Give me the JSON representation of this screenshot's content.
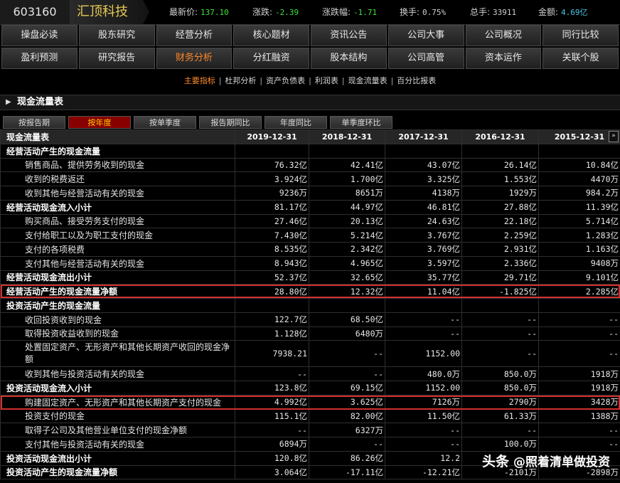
{
  "header": {
    "code": "603160",
    "name": "汇顶科技",
    "quotes": [
      {
        "k": "最新价:",
        "v": "137.10",
        "color": "green"
      },
      {
        "k": "涨跌:",
        "v": "-2.39",
        "color": "green"
      },
      {
        "k": "涨跌幅:",
        "v": "-1.71",
        "color": "green"
      },
      {
        "k": "换手:",
        "v": "0.75%",
        "color": "gray"
      },
      {
        "k": "总手:",
        "v": "33911",
        "color": "gray"
      },
      {
        "k": "金额:",
        "v": "4.69亿",
        "color": "cyan"
      }
    ]
  },
  "nav_row1": [
    "操盘必读",
    "股东研究",
    "经营分析",
    "核心题材",
    "资讯公告",
    "公司大事",
    "公司概况",
    "同行比较"
  ],
  "nav_row2": [
    "盈利预测",
    "研究报告",
    "财务分析",
    "分红融资",
    "股本结构",
    "公司高管",
    "资本运作",
    "关联个股"
  ],
  "subnav": [
    "主要指标",
    "杜邦分析",
    "资产负债表",
    "利润表",
    "现金流量表",
    "百分比报表"
  ],
  "section_title": "现金流量表",
  "tabs": [
    "按报告期",
    "按年度",
    "按单季度",
    "报告期同比",
    "年度同比",
    "单季度环比"
  ],
  "table": {
    "headers": [
      "现金流量表",
      "2019-12-31",
      "2018-12-31",
      "2017-12-31",
      "2016-12-31",
      "2015-12-31"
    ],
    "rows": [
      {
        "type": "h",
        "label": "经营活动产生的现金流量",
        "vals": [
          "",
          "",
          "",
          "",
          ""
        ]
      },
      {
        "type": "d",
        "label": "销售商品、提供劳务收到的现金",
        "vals": [
          "76.32亿",
          "42.41亿",
          "43.07亿",
          "26.14亿",
          "10.84亿"
        ]
      },
      {
        "type": "d",
        "label": "收到的税费返还",
        "vals": [
          "3.924亿",
          "1.700亿",
          "3.325亿",
          "1.553亿",
          "4470万"
        ]
      },
      {
        "type": "d",
        "label": "收到其他与经营活动有关的现金",
        "vals": [
          "9236万",
          "8651万",
          "4138万",
          "1929万",
          "984.2万"
        ]
      },
      {
        "type": "h",
        "label": "经营活动现金流入小计",
        "vals": [
          "81.17亿",
          "44.97亿",
          "46.81亿",
          "27.88亿",
          "11.39亿"
        ]
      },
      {
        "type": "d",
        "label": "购买商品、接受劳务支付的现金",
        "vals": [
          "27.46亿",
          "20.13亿",
          "24.63亿",
          "22.18亿",
          "5.714亿"
        ]
      },
      {
        "type": "d",
        "label": "支付给职工以及为职工支付的现金",
        "vals": [
          "7.430亿",
          "5.214亿",
          "3.767亿",
          "2.259亿",
          "1.283亿"
        ]
      },
      {
        "type": "d",
        "label": "支付的各项税费",
        "vals": [
          "8.535亿",
          "2.342亿",
          "3.769亿",
          "2.931亿",
          "1.163亿"
        ]
      },
      {
        "type": "d",
        "label": "支付其他与经营活动有关的现金",
        "vals": [
          "8.943亿",
          "4.965亿",
          "3.597亿",
          "2.336亿",
          "9408万"
        ]
      },
      {
        "type": "h",
        "label": "经营活动现金流出小计",
        "vals": [
          "52.37亿",
          "32.65亿",
          "35.77亿",
          "29.71亿",
          "9.101亿"
        ]
      },
      {
        "type": "h",
        "label": "经营活动产生的现金流量净额",
        "vals": [
          "28.80亿",
          "12.32亿",
          "11.04亿",
          "-1.825亿",
          "2.285亿"
        ]
      },
      {
        "type": "h",
        "label": "投资活动产生的现金流量",
        "vals": [
          "",
          "",
          "",
          "",
          ""
        ]
      },
      {
        "type": "d",
        "label": "收回投资收到的现金",
        "vals": [
          "122.7亿",
          "68.50亿",
          "--",
          "--",
          "--"
        ]
      },
      {
        "type": "d",
        "label": "取得投资收益收到的现金",
        "vals": [
          "1.128亿",
          "6480万",
          "--",
          "--",
          "--"
        ]
      },
      {
        "type": "t",
        "label": "处置固定资产、无形资产和其他长期资产收回的现金净额",
        "vals": [
          "7938.21",
          "--",
          "1152.00",
          "--",
          "--"
        ]
      },
      {
        "type": "d",
        "label": "收到其他与投资活动有关的现金",
        "vals": [
          "--",
          "--",
          "480.0万",
          "850.0万",
          "1918万"
        ]
      },
      {
        "type": "h",
        "label": "投资活动现金流入小计",
        "vals": [
          "123.8亿",
          "69.15亿",
          "1152.00",
          "850.0万",
          "1918万"
        ]
      },
      {
        "type": "d",
        "label": "购建固定资产、无形资产和其他长期资产支付的现金",
        "vals": [
          "4.992亿",
          "3.625亿",
          "7126万",
          "2790万",
          "3428万"
        ]
      },
      {
        "type": "d",
        "label": "投资支付的现金",
        "vals": [
          "115.1亿",
          "82.00亿",
          "11.50亿",
          "61.33万",
          "1388万"
        ]
      },
      {
        "type": "d",
        "label": "取得子公司及其他营业单位支付的现金净额",
        "vals": [
          "--",
          "6327万",
          "--",
          "--",
          "--"
        ]
      },
      {
        "type": "d",
        "label": "支付其他与投资活动有关的现金",
        "vals": [
          "6894万",
          "--",
          "--",
          "100.0万",
          "--"
        ]
      },
      {
        "type": "h",
        "label": "投资活动现金流出小计",
        "vals": [
          "120.8亿",
          "86.26亿",
          "12.2",
          "",
          ""
        ]
      },
      {
        "type": "h",
        "label": "投资活动产生的现金流量净额",
        "vals": [
          "3.064亿",
          "-17.11亿",
          "-12.21亿",
          "-2101万",
          "-2898万"
        ]
      }
    ]
  },
  "watermark": {
    "brand": "头条",
    "text": "@照着清单做投资"
  }
}
